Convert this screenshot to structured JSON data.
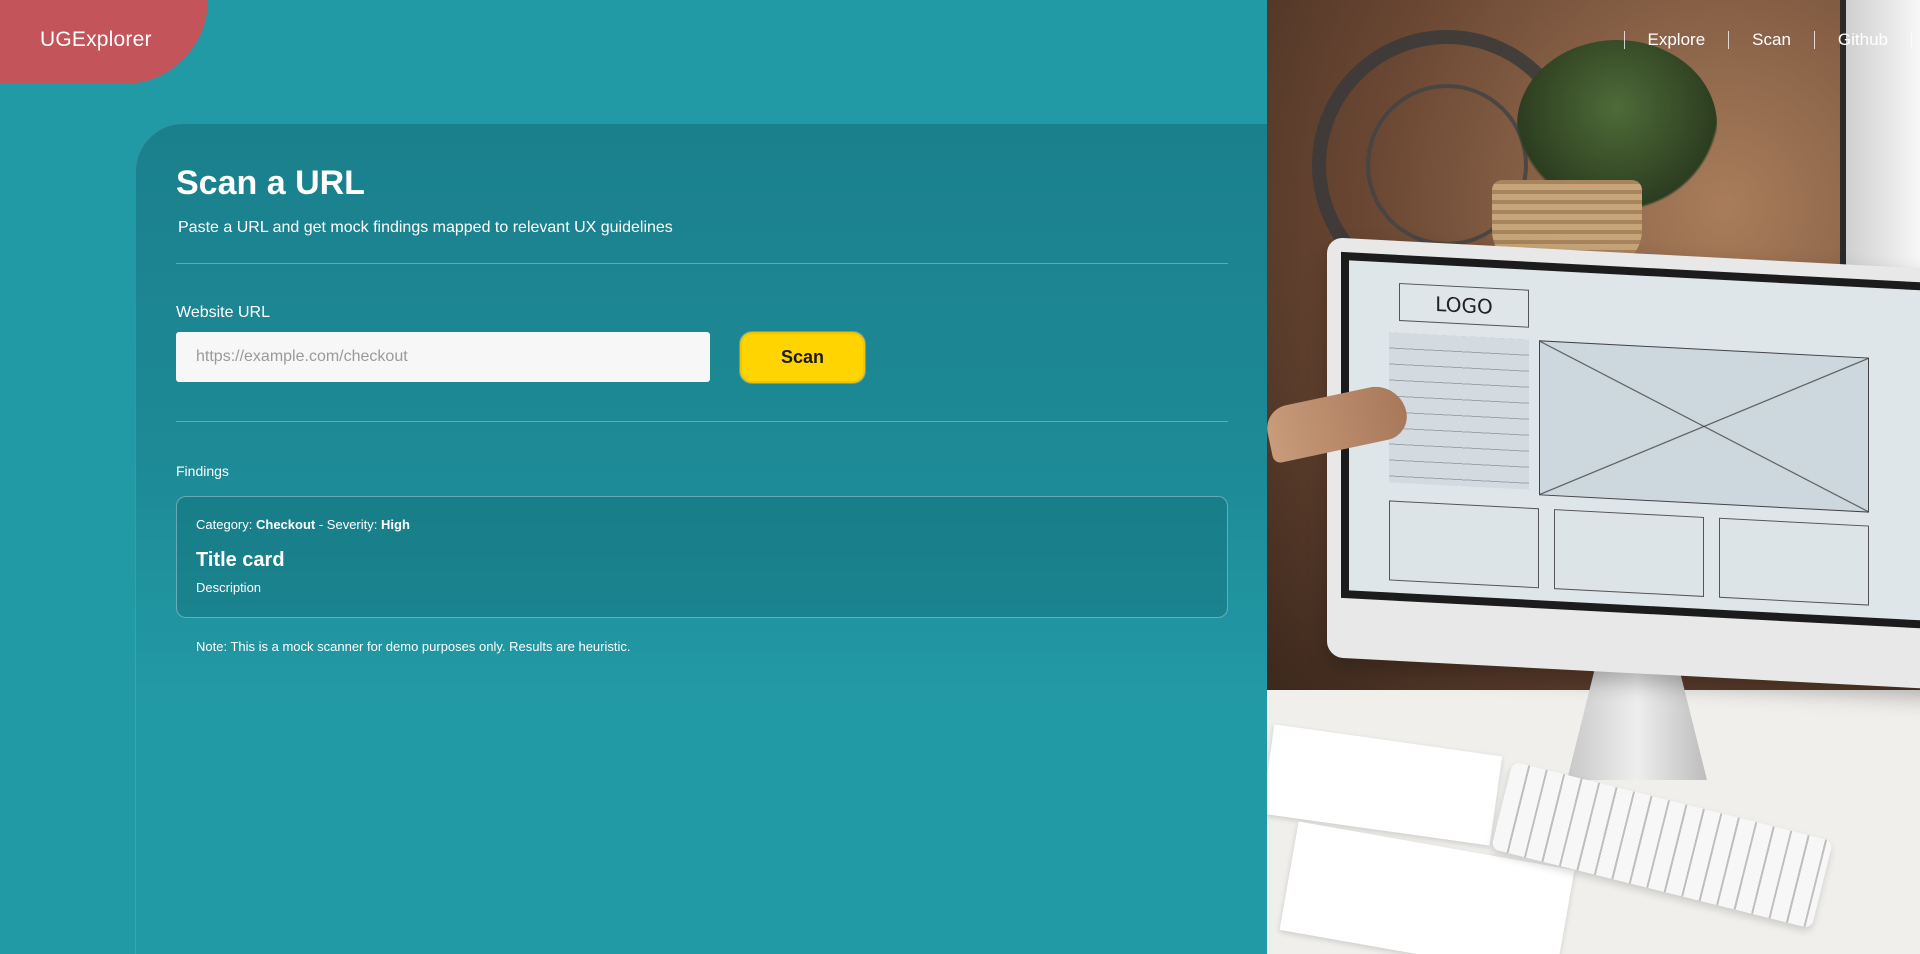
{
  "brand": {
    "name": "UGExplorer",
    "color": "#c2545a"
  },
  "nav": {
    "items": [
      "Explore",
      "Scan",
      "Github"
    ]
  },
  "scan": {
    "title": "Scan a URL",
    "subtitle": "Paste a URL and get mock findings mapped to relevant UX guidelines",
    "url_label": "Website URL",
    "url_placeholder": "https://example.com/checkout",
    "url_value": "",
    "button_label": "Scan",
    "button_color": "#ffd400"
  },
  "findings": {
    "label": "Findings",
    "items": [
      {
        "category_label": "Category:",
        "category": "Checkout",
        "severity_label": "- Severity:",
        "severity": "High",
        "title": "Title card",
        "description": "Description"
      }
    ],
    "note": "Note: This is a mock scanner for demo purposes only. Results are heuristic."
  },
  "photo": {
    "alt_icon": "photo-hero-image",
    "screen_logo_text": "LOGO"
  },
  "colors": {
    "background": "#229aa6",
    "panel": "#1a808c"
  }
}
